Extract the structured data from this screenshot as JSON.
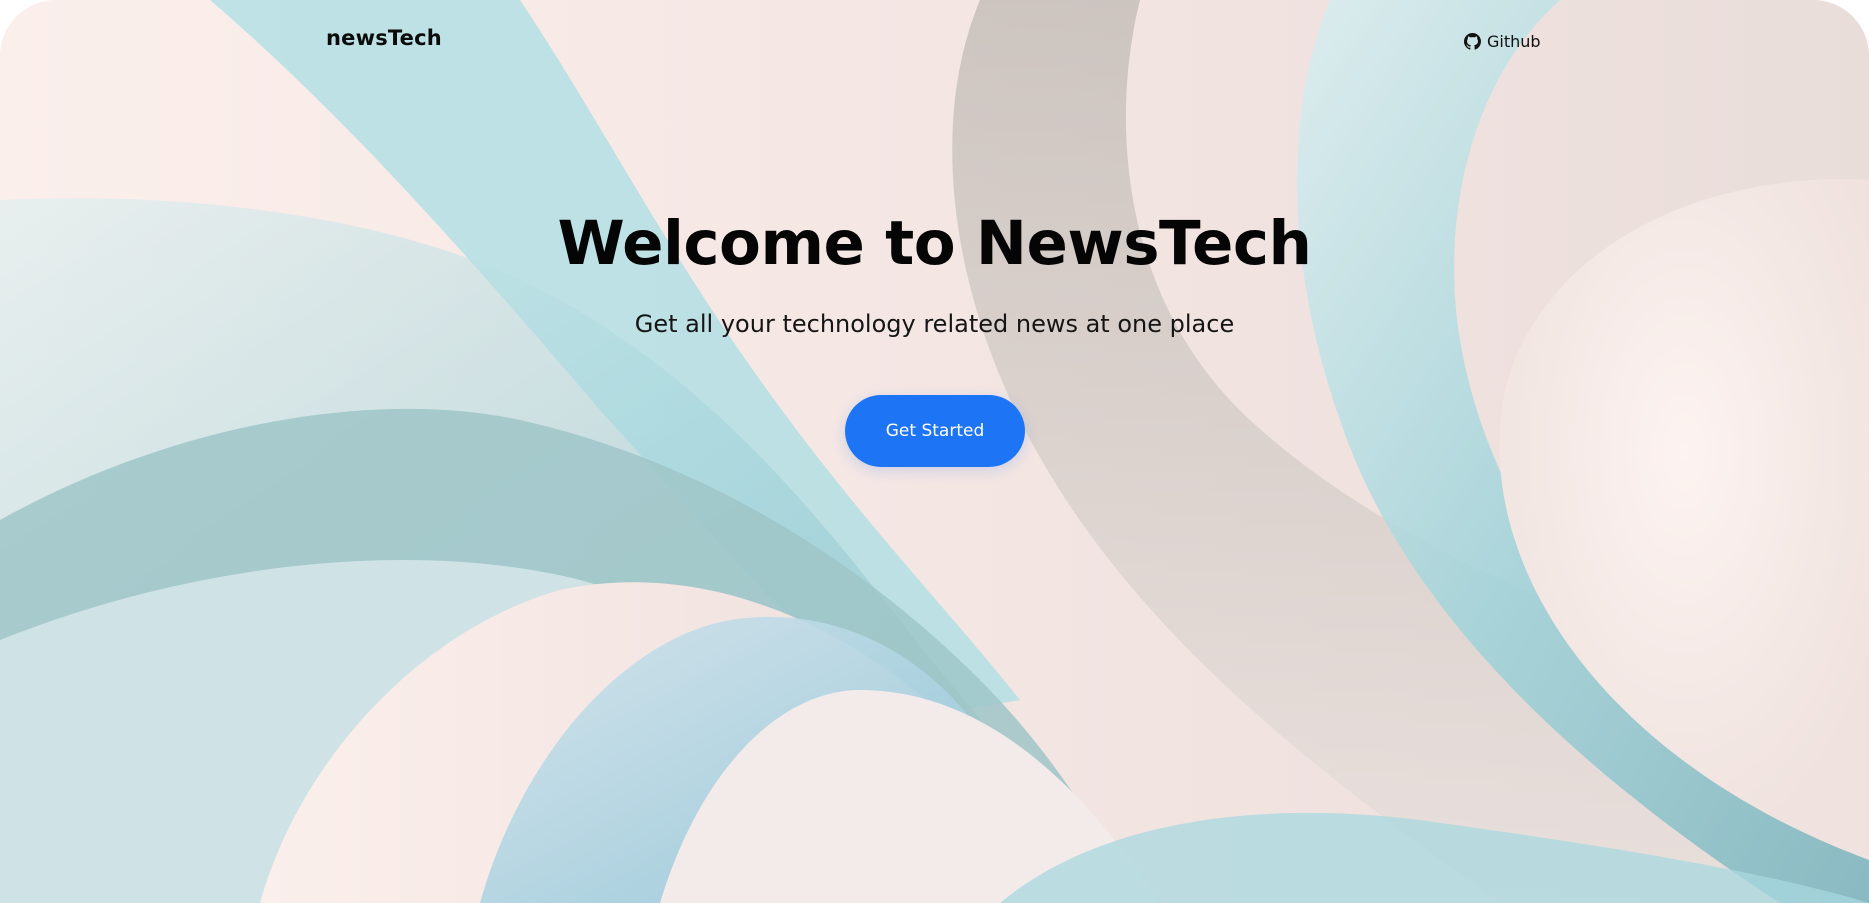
{
  "navbar": {
    "brand": "newsTech",
    "github_label": "Github"
  },
  "hero": {
    "title": "Welcome to NewsTech",
    "subtitle": "Get all your technology related news at one place",
    "cta_label": "Get Started"
  },
  "colors": {
    "accent": "#1d74f5",
    "text": "#0b0b0b",
    "background": "#f7ecea"
  },
  "icons": {
    "github": "github-icon"
  }
}
